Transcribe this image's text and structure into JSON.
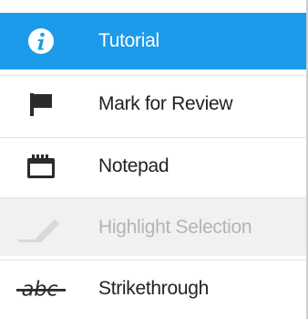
{
  "menu": {
    "items": [
      {
        "label": "Tutorial",
        "icon": "info-icon",
        "state": "selected"
      },
      {
        "label": "Mark for Review",
        "icon": "flag-icon",
        "state": "normal"
      },
      {
        "label": "Notepad",
        "icon": "notepad-icon",
        "state": "normal"
      },
      {
        "label": "Highlight Selection",
        "icon": "highlighter-icon",
        "state": "disabled"
      },
      {
        "label": "Strikethrough",
        "icon": "strikethrough-icon",
        "state": "normal"
      }
    ]
  },
  "colors": {
    "selected_background": "#1b9bea",
    "disabled_background": "#f1f1f1",
    "disabled_text": "#b4b4b4",
    "text": "#222222"
  }
}
